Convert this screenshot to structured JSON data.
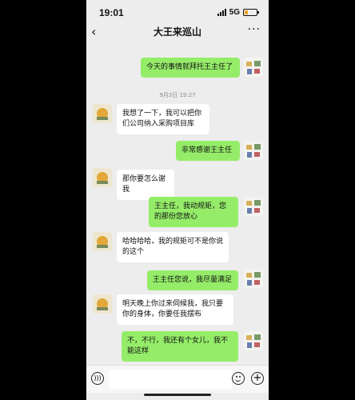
{
  "status": {
    "time": "19:01",
    "network": "5G",
    "battery_level": 0.25
  },
  "header": {
    "title": "大王来巡山",
    "back_icon": "chevron-left-icon",
    "more_icon": "more-dots-icon"
  },
  "messages": [
    {
      "side": "out",
      "text": "今天的事情就拜托王主任了"
    },
    {
      "timestamp": "9月3日 19:27"
    },
    {
      "side": "in",
      "text": "我想了一下，我可以把你们公司纳入采购项目库"
    },
    {
      "side": "out",
      "text": "非常感谢王主任"
    },
    {
      "side": "in",
      "text": "那你要怎么谢我"
    },
    {
      "side": "out",
      "text": "王主任，我动规矩，您的那份您放心"
    },
    {
      "side": "in",
      "text": "哈哈哈哈，我的规矩可不是你说的这个"
    },
    {
      "side": "out",
      "text": "王主任您说，我尽量满足"
    },
    {
      "side": "in",
      "text": "明天晚上你过来伺候我，我只要你的身体，你要任我摆布"
    },
    {
      "side": "out",
      "text": "不，不行，我还有个女儿，我不能这样"
    }
  ],
  "input_bar": {
    "voice_icon": "voice-icon",
    "emoji_icon": "emoji-icon",
    "plus_icon": "plus-icon",
    "text_value": ""
  },
  "colors": {
    "incoming": "#ffffff",
    "outgoing": "#95ec69",
    "background": "#ededed"
  }
}
